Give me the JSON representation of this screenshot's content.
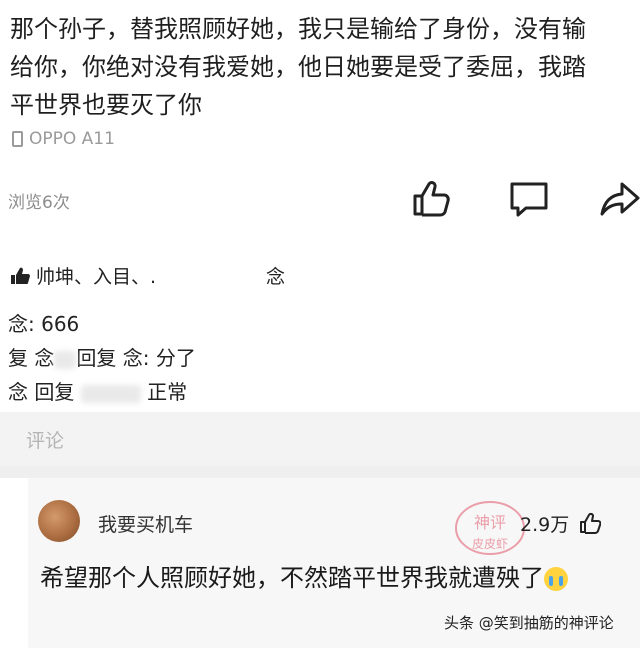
{
  "post": {
    "text": "那个孙子，替我照顾好她，我只是输给了身份，没有输\n给你，你绝对没有我爱她，他日她要是受了委屈，我踏\n平世界也要灭了你",
    "device": "OPPO A11",
    "views": "浏览6次"
  },
  "actions": {
    "like_icon": "thumbs-up-icon",
    "comment_icon": "comment-icon",
    "share_icon": "share-icon"
  },
  "likes": {
    "names": "帅坤、入目、.",
    "tail": "念"
  },
  "comments": [
    {
      "author": "念",
      "sep": ": ",
      "text": "666"
    },
    {
      "author": "复 念",
      "reply_label": "回复",
      "target": "念",
      "sep": ": ",
      "text": "分了"
    },
    {
      "author": "念",
      "reply_label": "回复",
      "sep": "",
      "text": "正常"
    }
  ],
  "comment_input": {
    "placeholder": "评论"
  },
  "top_comment": {
    "username": "我要买机车",
    "likes": "2.9万",
    "text": "希望那个人照顾好她，不然踏平世界我就遭殃了",
    "emoji": "crying-emoji"
  },
  "watermark": {
    "line1": "神评",
    "line2": "皮皮虾"
  },
  "source": "头条 @笑到抽筋的神评论",
  "colors": {
    "accent_watermark": "#e0566a",
    "muted_text": "#9a9a9a"
  }
}
